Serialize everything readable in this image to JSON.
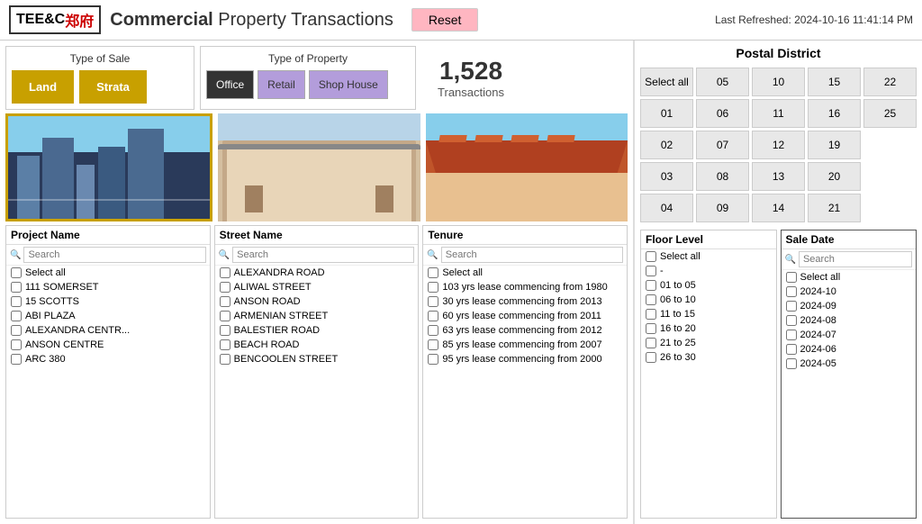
{
  "header": {
    "logo_text": "TEE&C郑府",
    "title_bold": "Commercial",
    "title_rest": " Property Transactions",
    "reset_label": "Reset",
    "last_refreshed_label": "Last Refreshed:",
    "last_refreshed_value": "2024-10-16 11:41:14 PM"
  },
  "type_of_sale": {
    "title": "Type of Sale",
    "buttons": [
      {
        "label": "Land",
        "active": true
      },
      {
        "label": "Strata",
        "active": true
      }
    ]
  },
  "type_of_property": {
    "title": "Type of Property",
    "buttons": [
      {
        "label": "Office",
        "active": true
      },
      {
        "label": "Retail",
        "active": true
      },
      {
        "label": "Shop\nHouse",
        "active": true
      }
    ]
  },
  "transactions": {
    "count": "1,528",
    "label": "Transactions"
  },
  "postal_district": {
    "title": "Postal District",
    "buttons": [
      "Select all",
      "05",
      "10",
      "15",
      "22",
      "01",
      "06",
      "11",
      "16",
      "25",
      "02",
      "07",
      "12",
      "19",
      "",
      "03",
      "08",
      "13",
      "20",
      "",
      "04",
      "09",
      "14",
      "21",
      ""
    ]
  },
  "filters": {
    "project_name": {
      "title": "Project Name",
      "search_placeholder": "Search",
      "items": [
        {
          "label": "Select all"
        },
        {
          "label": "111 SOMERSET"
        },
        {
          "label": "15 SCOTTS"
        },
        {
          "label": "ABI PLAZA"
        },
        {
          "label": "ALEXANDRA CENTR..."
        },
        {
          "label": "ANSON CENTRE"
        },
        {
          "label": "ARC 380"
        }
      ]
    },
    "street_name": {
      "title": "Street Name",
      "search_placeholder": "Search",
      "items": [
        {
          "label": "ALEXANDRA ROAD"
        },
        {
          "label": "ALIWAL STREET"
        },
        {
          "label": "ANSON ROAD"
        },
        {
          "label": "ARMENIAN STREET"
        },
        {
          "label": "BALESTIER ROAD"
        },
        {
          "label": "BEACH ROAD"
        },
        {
          "label": "BENCOOLEN STREET"
        }
      ]
    },
    "tenure": {
      "title": "Tenure",
      "search_placeholder": "Search",
      "items": [
        {
          "label": "Select all"
        },
        {
          "label": "103 yrs lease commencing from 1980"
        },
        {
          "label": "30 yrs lease commencing from 2013"
        },
        {
          "label": "60 yrs lease commencing from 2011"
        },
        {
          "label": "63 yrs lease commencing from 2012"
        },
        {
          "label": "85 yrs lease commencing from 2007"
        },
        {
          "label": "95 yrs lease commencing from 2000"
        }
      ]
    },
    "floor_level": {
      "title": "Floor Level",
      "items": [
        {
          "label": "Select all"
        },
        {
          "label": "-"
        },
        {
          "label": "01 to 05"
        },
        {
          "label": "06 to 10"
        },
        {
          "label": "11 to 15"
        },
        {
          "label": "16 to 20"
        },
        {
          "label": "21 to 25"
        },
        {
          "label": "26 to 30"
        }
      ]
    },
    "sale_date": {
      "title": "Sale Date",
      "search_placeholder": "Search",
      "items": [
        {
          "label": "Select all"
        },
        {
          "label": "2024-10"
        },
        {
          "label": "2024-09"
        },
        {
          "label": "2024-08"
        },
        {
          "label": "2024-07"
        },
        {
          "label": "2024-06"
        },
        {
          "label": "2024-05"
        }
      ]
    }
  }
}
